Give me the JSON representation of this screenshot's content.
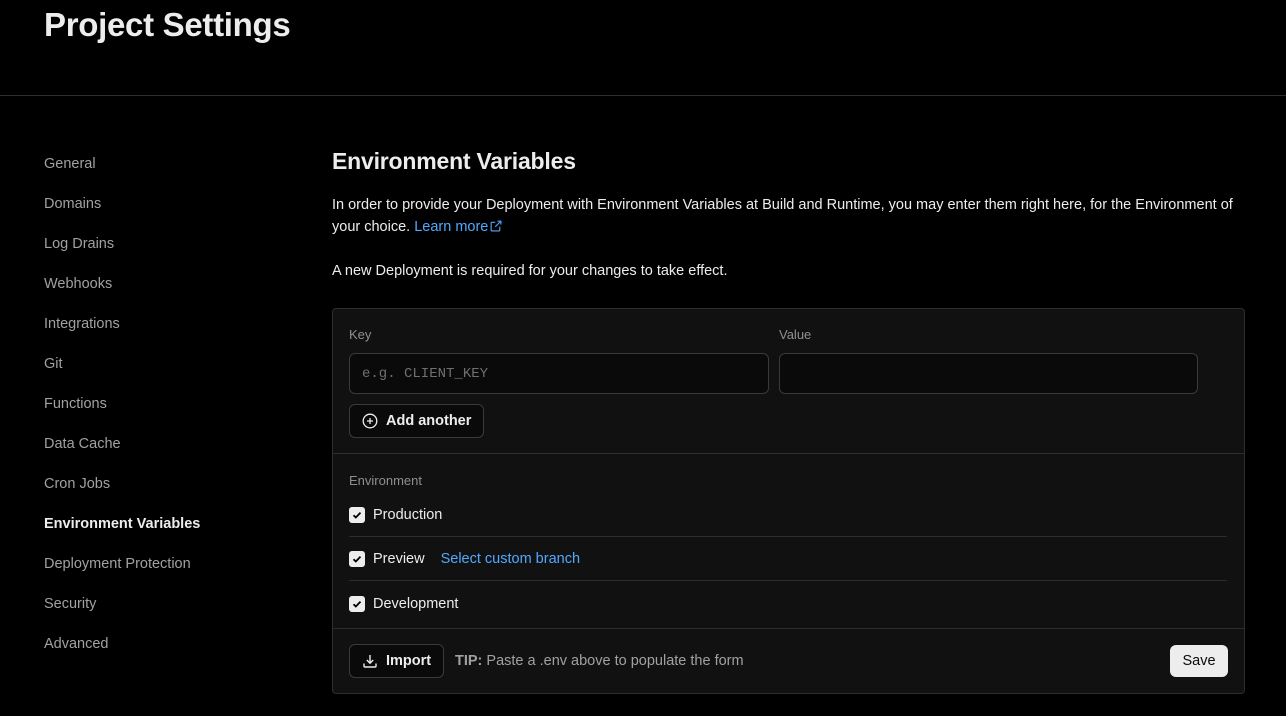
{
  "header": {
    "title": "Project Settings"
  },
  "sidebar": {
    "items": [
      {
        "label": "General"
      },
      {
        "label": "Domains"
      },
      {
        "label": "Log Drains"
      },
      {
        "label": "Webhooks"
      },
      {
        "label": "Integrations"
      },
      {
        "label": "Git"
      },
      {
        "label": "Functions"
      },
      {
        "label": "Data Cache"
      },
      {
        "label": "Cron Jobs"
      },
      {
        "label": "Environment Variables",
        "active": true
      },
      {
        "label": "Deployment Protection"
      },
      {
        "label": "Security"
      },
      {
        "label": "Advanced"
      }
    ]
  },
  "main": {
    "title": "Environment Variables",
    "description": "In order to provide your Deployment with Environment Variables at Build and Runtime, you may enter them right here, for the Environment of your choice.",
    "learn_more": "Learn more",
    "notice": "A new Deployment is required for your changes to take effect.",
    "form": {
      "key_label": "Key",
      "key_placeholder": "e.g. CLIENT_KEY",
      "key_value": "",
      "value_label": "Value",
      "value_value": "",
      "add_another": "Add another",
      "environment_label": "Environment",
      "environments": [
        {
          "name": "Production",
          "checked": true
        },
        {
          "name": "Preview",
          "checked": true,
          "link": "Select custom branch"
        },
        {
          "name": "Development",
          "checked": true
        }
      ],
      "import_label": "Import",
      "tip_prefix": "TIP:",
      "tip_text": "Paste a .env above to populate the form",
      "save_label": "Save"
    }
  },
  "colors": {
    "background": "#000000",
    "card": "#111111",
    "link": "#52a8ff",
    "text": "#ededed",
    "muted": "#a1a1a1"
  }
}
